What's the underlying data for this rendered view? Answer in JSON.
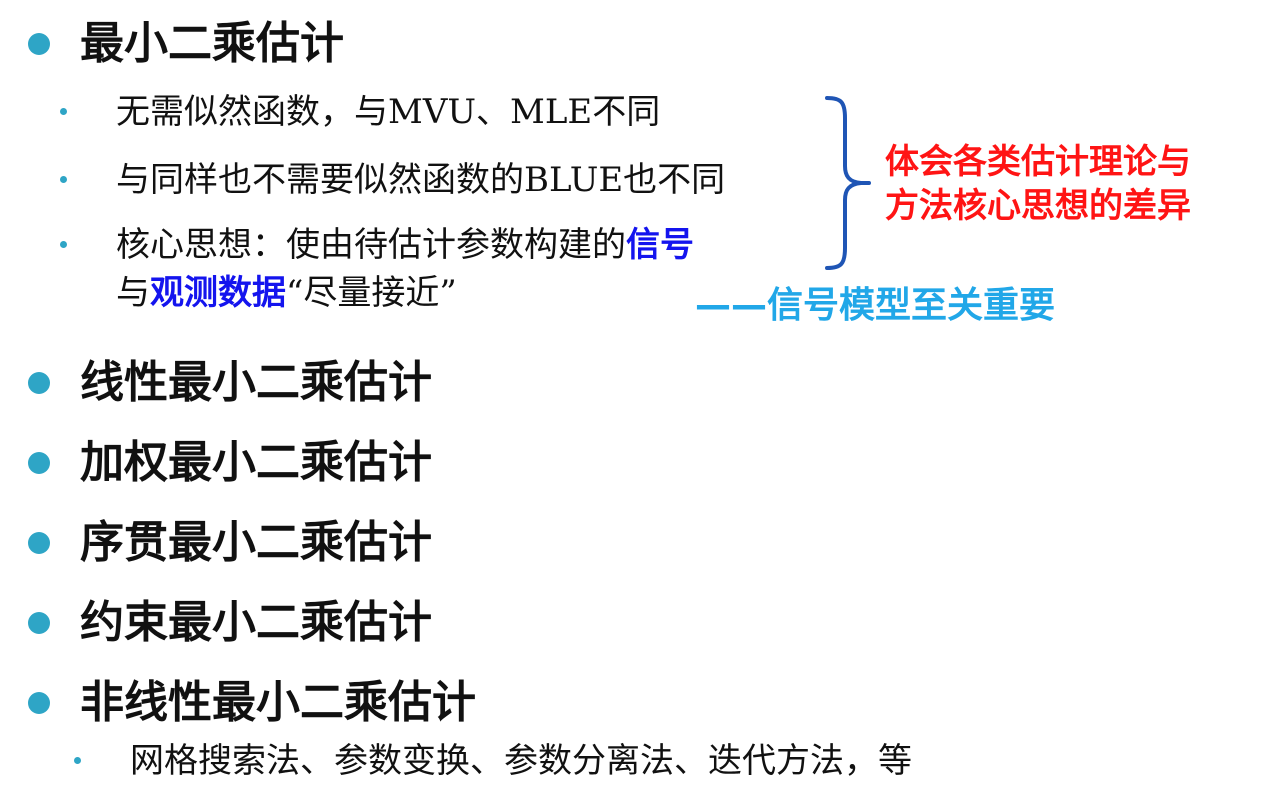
{
  "slide": {
    "main_items": [
      "最小二乘估计",
      "线性最小二乘估计",
      "加权最小二乘估计",
      "序贯最小二乘估计",
      "约束最小二乘估计",
      "非线性最小二乘估计"
    ],
    "least_squares_points": {
      "point_1": "无需似然函数，与MVU、MLE不同",
      "point_2": "与同样也不需要似然函数的BLUE也不同",
      "point_3": {
        "prefix": "核心思想：使由待估计参数构建的",
        "highlight_1": "信号",
        "middle": "与",
        "highlight_2": "观测数据",
        "suffix": "“尽量接近”"
      }
    },
    "nonlinear_points": {
      "point_1": "网格搜索法、参数变换、参数分离法、迭代方法，等"
    },
    "side_notes": {
      "red_line_1": "体会各类估计理论与",
      "red_line_2": "方法核心思想的差异",
      "signal_model": "——信号模型至关重要"
    },
    "colors": {
      "bullet": "#2ea5c6",
      "keyword": "#1414ee",
      "note_red": "#ff1414",
      "note_cyan": "#21a7e8",
      "brace": "#1f55b5"
    }
  }
}
